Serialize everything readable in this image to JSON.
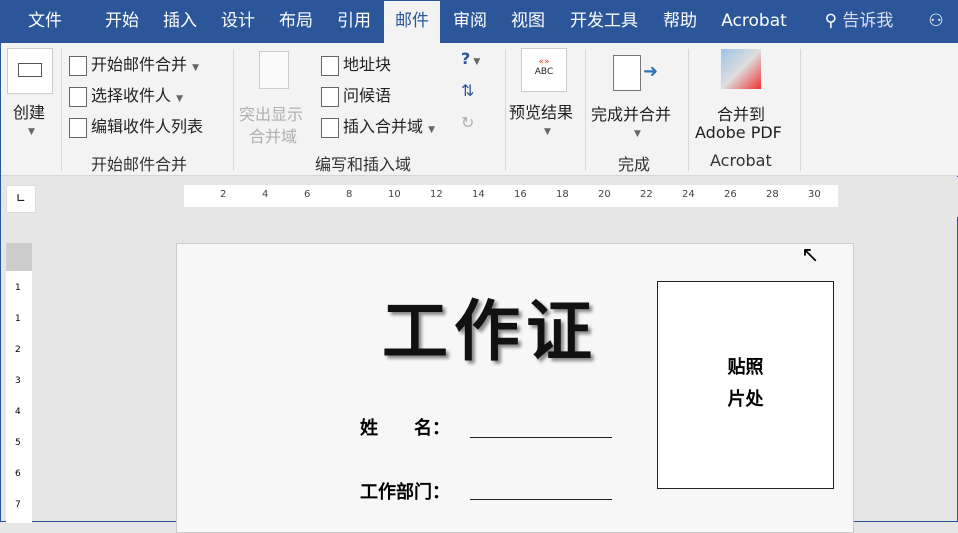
{
  "tabs": [
    "文件",
    "开始",
    "插入",
    "设计",
    "布局",
    "引用",
    "邮件",
    "审阅",
    "视图",
    "开发工具",
    "帮助",
    "Acrobat"
  ],
  "tell_me": "告诉我",
  "ribbon": {
    "create": "创建",
    "start_merge": "开始邮件合并",
    "select_recipients": "选择收件人",
    "edit_recipients": "编辑收件人列表",
    "group_start": "开始邮件合并",
    "highlight_1": "突出显示",
    "highlight_2": "合并域",
    "address_block": "地址块",
    "greeting": "问候语",
    "insert_field": "插入合并域",
    "group_write": "编写和插入域",
    "preview": "预览结果",
    "preview_icon": "ABC",
    "finish": "完成并合并",
    "group_finish": "完成",
    "merge_pdf_1": "合并到",
    "merge_pdf_2": "Adobe PDF",
    "group_acrobat": "Acrobat"
  },
  "ruler": [
    "2",
    "4",
    "6",
    "8",
    "10",
    "12",
    "14",
    "16",
    "18",
    "20",
    "22",
    "24",
    "26",
    "28",
    "30"
  ],
  "vruler": [
    "1",
    "1",
    "2",
    "3",
    "4",
    "5",
    "6",
    "7"
  ],
  "doc": {
    "title": "工作证",
    "photo_1": "贴照",
    "photo_2": "片处",
    "name_label": "姓　　名：",
    "dept_label": "工作部门："
  }
}
